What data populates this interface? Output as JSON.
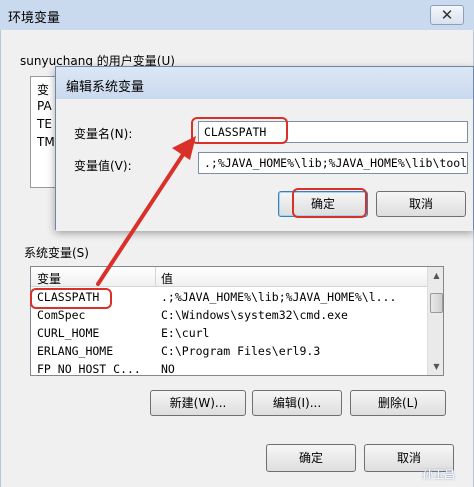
{
  "outer": {
    "title": "环境变量",
    "close": "✕",
    "user_section_label": "sunyuchang 的用户变量(U)",
    "user_vars": [
      "变",
      "PA",
      "TE",
      "TM"
    ],
    "system_section_label": "系统变量(S)",
    "table_headers": {
      "name": "变量",
      "value": "值"
    },
    "system_vars": [
      {
        "name": "CLASSPATH",
        "value": ".;%JAVA_HOME%\\lib;%JAVA_HOME%\\l..."
      },
      {
        "name": "ComSpec",
        "value": "C:\\Windows\\system32\\cmd.exe"
      },
      {
        "name": "CURL_HOME",
        "value": "E:\\curl"
      },
      {
        "name": "ERLANG_HOME",
        "value": "C:\\Program Files\\erl9.3"
      },
      {
        "name": "FP_NO_HOST_C...",
        "value": "NO"
      }
    ],
    "buttons": {
      "new": "新建(W)...",
      "edit": "编辑(I)...",
      "delete": "删除(L)",
      "ok": "确定",
      "cancel": "取消"
    }
  },
  "inner": {
    "title": "编辑系统变量",
    "name_label": "变量名(N):",
    "value_label": "变量值(V):",
    "name_value": "CLASSPATH",
    "value_value": ".;%JAVA_HOME%\\lib;%JAVA_HOME%\\lib\\tools.jar",
    "ok": "确定",
    "cancel": "取消"
  },
  "watermark": "孙玉昌",
  "colors": {
    "highlight": "#d9302a",
    "title_bar": "#c9d9ee"
  }
}
